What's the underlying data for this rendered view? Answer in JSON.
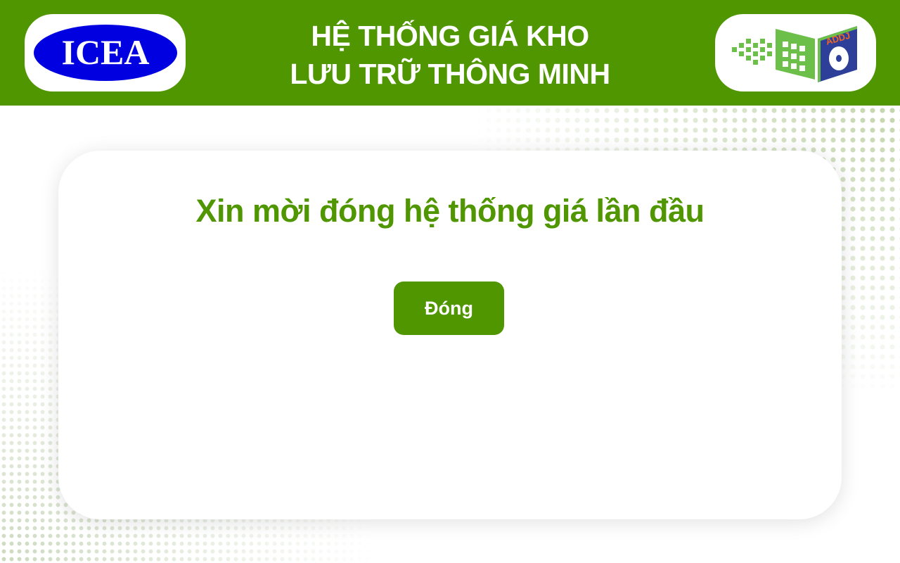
{
  "header": {
    "title_line1": "HỆ THỐNG GIÁ KHO",
    "title_line2": "LƯU TRỮ THÔNG MINH",
    "left_logo": {
      "text": "ICEA",
      "icon": "icea-logo-icon"
    },
    "right_logo": {
      "text": "ADDJ",
      "icon": "addj-logo-icon"
    }
  },
  "dialog": {
    "message": "Xin mời đóng hệ thống giá lần đầu",
    "close_label": "Đóng"
  },
  "colors": {
    "brand_green": "#4f9600",
    "logo_blue": "#0000e0",
    "logo_light_green": "#6cc04a",
    "logo_navy": "#2e3f9a",
    "logo_orange": "#f26522"
  }
}
